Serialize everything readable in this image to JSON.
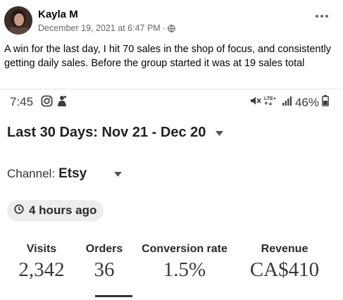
{
  "post": {
    "author": "Kayla M",
    "timestamp": "December 19, 2021 at 6:47 PM",
    "separator": "·",
    "privacy_icon": "globe-icon",
    "more_icon": "more-options-icon",
    "text": "A win for the last day, I hit 70 sales in the shop of focus, and consistently getting daily sales. Before the group started it was at 19 sales total"
  },
  "phone": {
    "status_bar": {
      "time": "7:45",
      "left_icons": [
        "instagram-icon",
        "notification-icon"
      ],
      "battery_percent": "46%",
      "network_label": "LTE+"
    },
    "date_range": "Last 30 Days: Nov 21 - Dec 20",
    "channel": {
      "prefix": "Channel:",
      "value": "Etsy"
    },
    "updated": "4 hours ago",
    "stats": {
      "visits": {
        "label": "Visits",
        "value": "2,342"
      },
      "orders": {
        "label": "Orders",
        "value": "36"
      },
      "conversion": {
        "label": "Conversion rate",
        "value": "1.5%"
      },
      "revenue": {
        "label": "Revenue",
        "value": "CA$410"
      }
    },
    "selected_stat": "orders"
  },
  "colors": {
    "text_primary": "#050505",
    "text_secondary": "#65676b",
    "chip_background": "#ededed",
    "selected_underline": "#333333"
  }
}
